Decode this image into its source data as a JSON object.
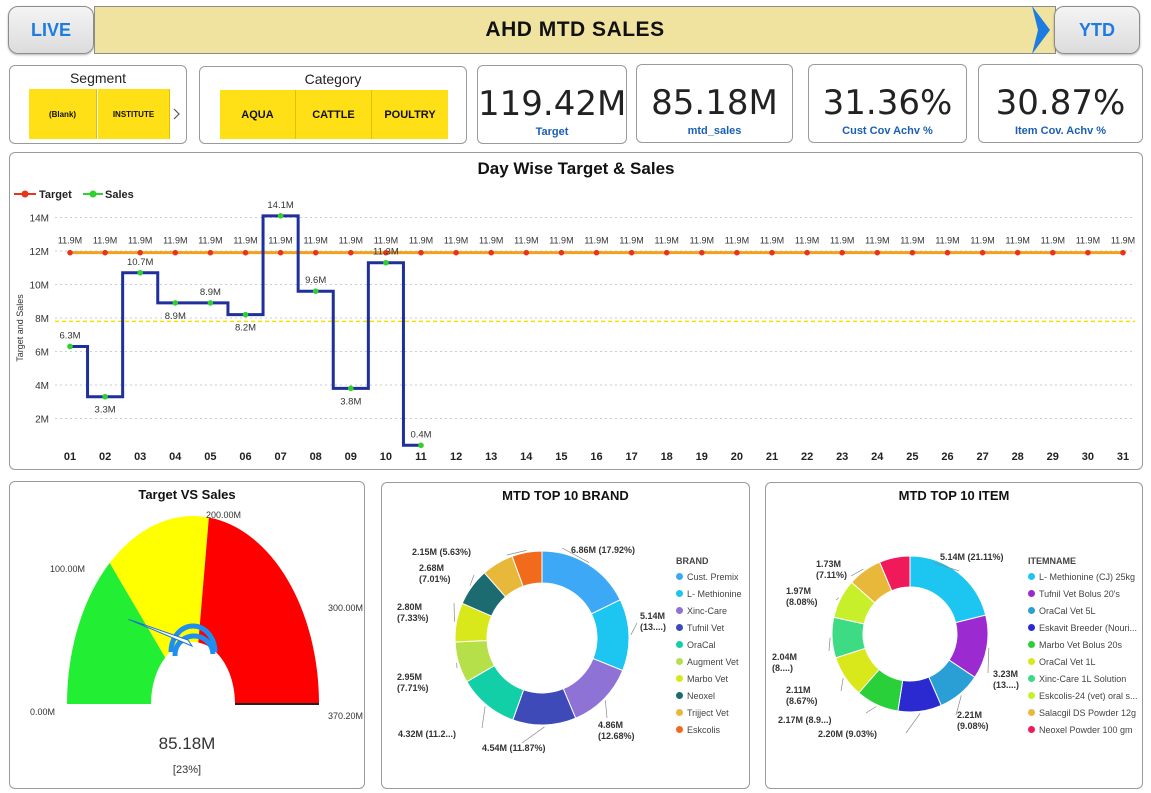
{
  "header": {
    "live_label": "LIVE",
    "title": "AHD MTD SALES",
    "ytd_label": "YTD"
  },
  "segment": {
    "title": "Segment",
    "options": [
      "(Blank)",
      "INSTITUTE"
    ],
    "more_icon": "chevron-right-icon"
  },
  "category": {
    "title": "Category",
    "options": [
      "AQUA",
      "CATTLE",
      "POULTRY"
    ]
  },
  "kpis": [
    {
      "value": "119.42M",
      "label": "Target"
    },
    {
      "value": "85.18M",
      "label": "mtd_sales"
    },
    {
      "value": "31.36%",
      "label": "Cust Cov Achv %"
    },
    {
      "value": "30.87%",
      "label": "Item Cov. Achv %"
    }
  ],
  "colors": {
    "accent": "#1e7be0",
    "slicer": "#ffe017",
    "target_line": "#f2a11f",
    "target_dot": "#e8341c",
    "sales_line": "#1f2f9c",
    "sales_dot": "#2fd12f",
    "ref_line": "#f5e000"
  },
  "chart_data": [
    {
      "type": "line",
      "title": "Day Wise Target & Sales",
      "xlabel": "",
      "ylabel": "Target and Sales",
      "x": [
        "01",
        "02",
        "03",
        "04",
        "05",
        "06",
        "07",
        "08",
        "09",
        "10",
        "11",
        "12",
        "13",
        "14",
        "15",
        "16",
        "17",
        "18",
        "19",
        "20",
        "21",
        "22",
        "23",
        "24",
        "25",
        "26",
        "27",
        "28",
        "29",
        "30",
        "31"
      ],
      "yticks": [
        "2M",
        "4M",
        "6M",
        "8M",
        "10M",
        "12M",
        "14M"
      ],
      "ylim": [
        0,
        14.5
      ],
      "legend": "top-left",
      "series": [
        {
          "name": "Target",
          "values": [
            11.9,
            11.9,
            11.9,
            11.9,
            11.9,
            11.9,
            11.9,
            11.9,
            11.9,
            11.9,
            11.9,
            11.9,
            11.9,
            11.9,
            11.9,
            11.9,
            11.9,
            11.9,
            11.9,
            11.9,
            11.9,
            11.9,
            11.9,
            11.9,
            11.9,
            11.9,
            11.9,
            11.9,
            11.9,
            11.9,
            11.9
          ],
          "labels": [
            "11.9M",
            "11.9M",
            "11.9M",
            "11.9M",
            "11.9M",
            "11.9M",
            "11.9M",
            "11.9M",
            "11.9M",
            "11.9M",
            "11.9M",
            "11.9M",
            "11.9M",
            "11.9M",
            "11.9M",
            "11.9M",
            "11.9M",
            "11.9M",
            "11.9M",
            "11.9M",
            "11.9M",
            "11.9M",
            "11.9M",
            "11.9M",
            "11.9M",
            "11.9M",
            "11.9M",
            "11.9M",
            "11.9M",
            "11.9M",
            "11.9M"
          ]
        },
        {
          "name": "Sales",
          "values": [
            6.3,
            3.3,
            10.7,
            8.9,
            8.9,
            8.2,
            14.1,
            9.6,
            3.8,
            11.3,
            0.4
          ],
          "labels": [
            "6.3M",
            "3.3M",
            "10.7M",
            "8.9M",
            "8.9M",
            "8.2M",
            "14.1M",
            "9.6M",
            "3.8M",
            "11.3M",
            "0.4M"
          ]
        }
      ],
      "reference_line": 7.8,
      "grid": true
    },
    {
      "type": "gauge",
      "title": "Target VS Sales",
      "min": 0,
      "max": 370.2,
      "bands": [
        {
          "to": 100,
          "color": "#22ee33"
        },
        {
          "to": 200,
          "color": "#ffff00"
        },
        {
          "to": 370.2,
          "color": "#ff0000"
        }
      ],
      "tick_labels": [
        "0.00M",
        "100.00M",
        "200.00M",
        "300.00M",
        "370.20M"
      ],
      "value": 85.18,
      "value_label": "85.18M",
      "percent_label": "[23%]"
    },
    {
      "type": "pie",
      "title": "MTD TOP 10 BRAND",
      "legend_title": "BRAND",
      "categories": [
        "Cust. Premix",
        "L- Methionine",
        "Xinc-Care",
        "Tufnil Vet",
        "OraCal",
        "Augment Vet",
        "Marbo Vet",
        "Neoxel",
        "Trijject Vet",
        "Eskcolis"
      ],
      "values": [
        6.86,
        5.14,
        4.86,
        4.54,
        4.32,
        2.95,
        2.8,
        2.68,
        2.3,
        2.15
      ],
      "colors": [
        "#3da8f5",
        "#1cc6f0",
        "#8f72d6",
        "#3d4ab8",
        "#12cfa8",
        "#b6e04a",
        "#d8e81a",
        "#1c6b70",
        "#e8b83a",
        "#f26b1d"
      ],
      "labels": [
        "6.86M (17.92%)",
        "5.14M (13....)",
        "4.86M (12.68%)",
        "4.54M (11.87%)",
        "4.32M (11.2...)",
        "2.95M (7.71%)",
        "2.80M (7.33%)",
        "2.68M (7.01%)",
        "",
        "2.15M (5.63%)"
      ]
    },
    {
      "type": "pie",
      "title": "MTD TOP 10 ITEM",
      "legend_title": "ITEMNAME",
      "categories": [
        "L- Methionine (CJ) 25kg",
        "Tufnil Vet Bolus 20's",
        "OraCal Vet 5L",
        "Eskavit Breeder (Nouri...",
        "Marbo Vet Bolus 20s",
        "OraCal Vet 1L",
        "Xinc-Care 1L Solution",
        "Eskcolis-24 (vet) oral s...",
        "Salacgil DS Powder 12g",
        "Neoxel Powder 100 gm"
      ],
      "values": [
        5.14,
        3.23,
        2.21,
        2.2,
        2.17,
        2.11,
        2.04,
        1.97,
        1.73,
        1.55
      ],
      "colors": [
        "#1cc6f0",
        "#9b2ad0",
        "#2a9fd6",
        "#2a2ad0",
        "#2ad03a",
        "#d8e81a",
        "#3ddc84",
        "#c8f02a",
        "#e8b83a",
        "#f0195a"
      ],
      "labels": [
        "5.14M (21.11%)",
        "3.23M (13....)",
        "2.21M (9.08%)",
        "2.20M (9.03%)",
        "2.17M (8.9...)",
        "2.11M (8.67%)",
        "2.04M (8....)",
        "1.97M (8.08%)",
        "1.73M (7.11%)",
        ""
      ]
    }
  ]
}
